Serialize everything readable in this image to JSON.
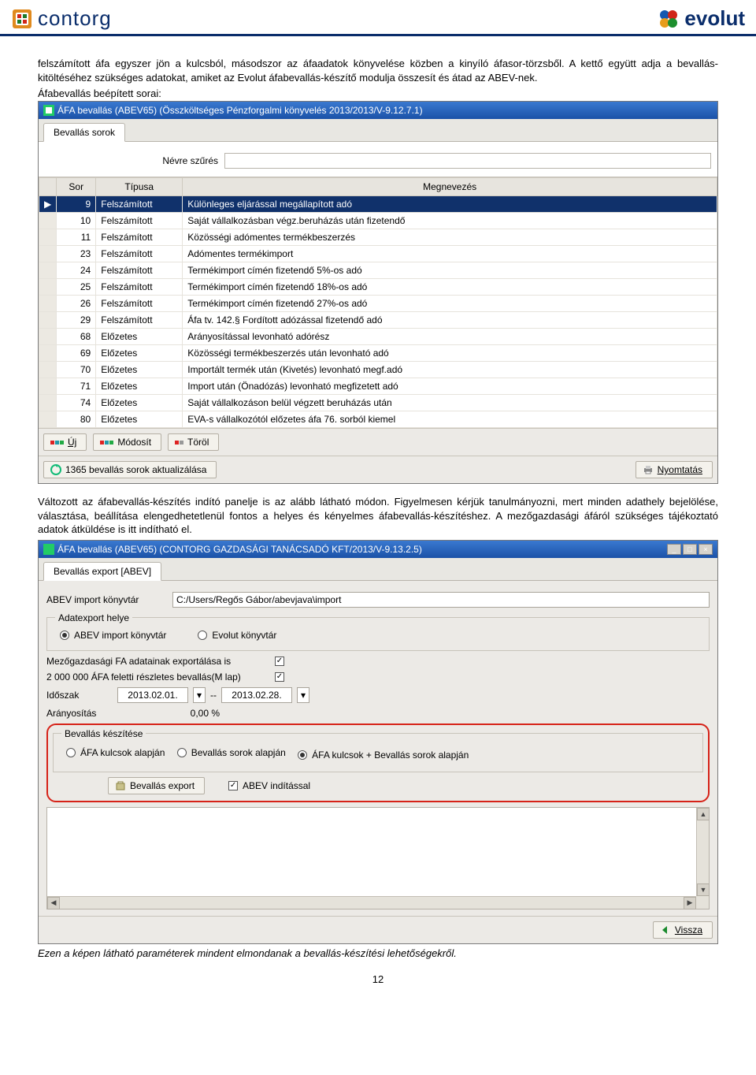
{
  "header": {
    "logo_left": "contorg",
    "logo_right": "evolut"
  },
  "intro_paragraph": "felszámított áfa egyszer jön a kulcsból, másodszor az áfaadatok könyvelése közben a kinyíló áfasor-törzsből. A kettő együtt adja a bevallás-kitöltéséhez szükséges adatokat, amiket az Evolut áfabevallás-készítő modulja összesít és átad az ABEV-nek.",
  "intro_line2": "Áfabevallás beépített sorai:",
  "win1": {
    "title": "ÁFA bevallás (ABEV65) (Összköltséges Pénzforgalmi könyvelés 2013/2013/V-9.12.7.1)",
    "tab": "Bevallás sorok",
    "filter_label": "Névre szűrés",
    "columns": {
      "sor": "Sor",
      "tipus": "Típusa",
      "megnev": "Megnevezés"
    },
    "rows": [
      {
        "sor": 9,
        "tipus": "Felszámított",
        "meg": "Különleges eljárással megállapított adó",
        "sel": true
      },
      {
        "sor": 10,
        "tipus": "Felszámított",
        "meg": "Saját vállalkozásban végz.beruházás után fizetendő"
      },
      {
        "sor": 11,
        "tipus": "Felszámított",
        "meg": "Közösségi adómentes termékbeszerzés"
      },
      {
        "sor": 23,
        "tipus": "Felszámított",
        "meg": "Adómentes termékimport"
      },
      {
        "sor": 24,
        "tipus": "Felszámított",
        "meg": "Termékimport címén fizetendő 5%-os adó"
      },
      {
        "sor": 25,
        "tipus": "Felszámított",
        "meg": "Termékimport címén fizetendő 18%-os adó"
      },
      {
        "sor": 26,
        "tipus": "Felszámított",
        "meg": "Termékimport címén fizetendő 27%-os adó"
      },
      {
        "sor": 29,
        "tipus": "Felszámított",
        "meg": "Áfa tv. 142.§ Fordított adózással fizetendő adó"
      },
      {
        "sor": 68,
        "tipus": "Előzetes",
        "meg": "Arányosítással levonható adórész"
      },
      {
        "sor": 69,
        "tipus": "Előzetes",
        "meg": "Közösségi termékbeszerzés után levonható adó"
      },
      {
        "sor": 70,
        "tipus": "Előzetes",
        "meg": "Importált termék után (Kivetés) levonható megf.adó"
      },
      {
        "sor": 71,
        "tipus": "Előzetes",
        "meg": "Import után (Önadózás) levonható megfizetett adó"
      },
      {
        "sor": 74,
        "tipus": "Előzetes",
        "meg": "Saját vállalkozáson belül végzett beruházás után"
      },
      {
        "sor": 80,
        "tipus": "Előzetes",
        "meg": "EVA-s vállalkozótól előzetes áfa 76. sorból kiemel"
      }
    ],
    "buttons": {
      "new": "Új",
      "edit": "Módosít",
      "del": "Töröl"
    },
    "refresh": "1365 bevallás sorok aktualizálása",
    "print": "Nyomtatás"
  },
  "mid_paragraph": "Változott az áfabevallás-készítés indító panelje is az alább látható módon. Figyelmesen kérjük tanulmányozni, mert minden adathely bejelölése, választása, beállítása elengedhetetlenül fontos a helyes és kényelmes áfabevallás-készítéshez. A mezőgazdasági áfáról szükséges tájékoztató adatok átküldése is itt indítható el.",
  "win2": {
    "title": "ÁFA bevallás (ABEV65) (CONTORG GAZDASÁGI TANÁCSADÓ KFT/2013/V-9.13.2.5)",
    "tab": "Bevallás export [ABEV]",
    "path_label": "ABEV import könyvtár",
    "path_value": "C:/Users/Regős Gábor/abevjava\\import",
    "group_helye": "Adatexport helye",
    "radio_abev": "ABEV import könyvtár",
    "radio_evolut": "Evolut könyvtár",
    "line_mezogazd": "Mezőgazdasági FA adatainak exportálása is",
    "line_2m": "2 000 000 ÁFA feletti részletes bevallás(M lap)",
    "idoszak_label": "Időszak",
    "idoszak_from": "2013.02.01.",
    "idoszak_to": "2013.02.28.",
    "aranyositas_label": "Arányosítás",
    "aranyositas_value": "0,00 %",
    "group_keszites": "Bevallás készítése",
    "opt1": "ÁFA kulcsok alapján",
    "opt2": "Bevallás sorok alapján",
    "opt3": "ÁFA kulcsok + Bevallás sorok alapján",
    "export_btn": "Bevallás export",
    "abev_inditas": "ABEV indítással",
    "back": "Vissza"
  },
  "closing_line": "Ezen a képen látható paraméterek mindent elmondanak a bevallás-készítési lehetőségekről.",
  "page_number": "12"
}
